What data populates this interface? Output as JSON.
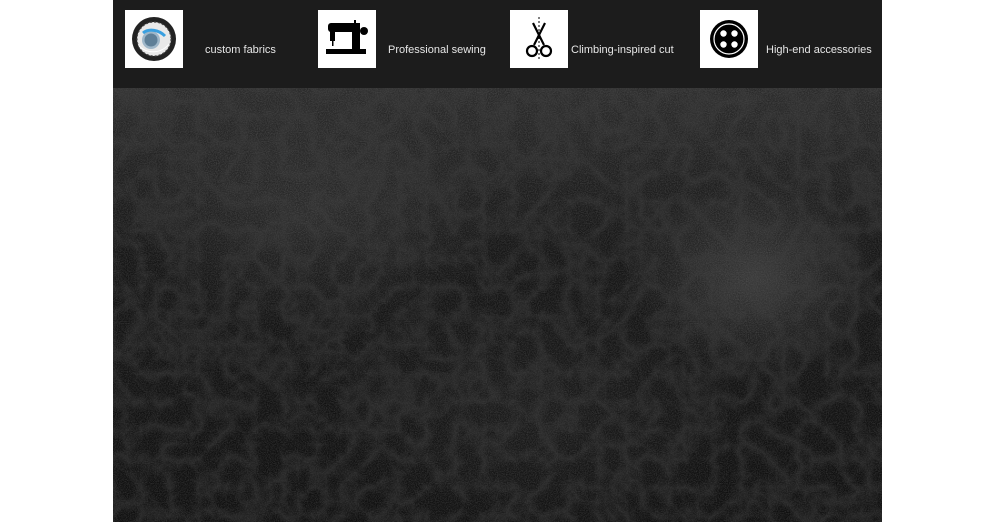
{
  "features": [
    {
      "icon": "fabric-badge-icon",
      "label": "custom fabrics"
    },
    {
      "icon": "sewing-machine-icon",
      "label": "Professional sewing"
    },
    {
      "icon": "scissors-icon",
      "label": "Climbing-inspired cut"
    },
    {
      "icon": "button-icon",
      "label": "High-end accessories"
    }
  ],
  "colors": {
    "bar_background": "#1c1c1c",
    "texture_base": "#151515",
    "label_text": "#e6e6e6",
    "icon_box": "#ffffff"
  }
}
